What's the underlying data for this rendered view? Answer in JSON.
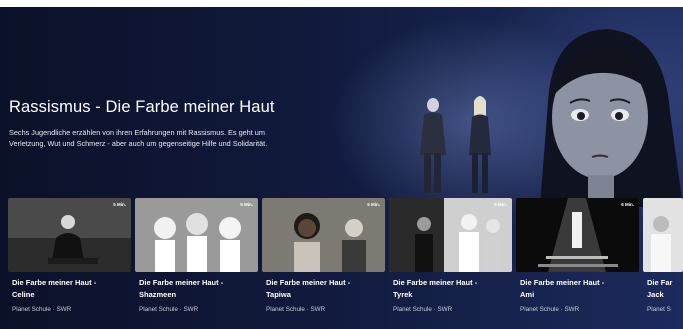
{
  "hero": {
    "title": "Rassismus - Die Farbe meiner Haut",
    "description": "Sechs Jugendliche erzählen von ihren Erfahrungen mit Rassismus. Es geht um Verletzung, Wut und Schmerz - aber auch um gegenseitige Hilfe und Solidarität."
  },
  "episodes": [
    {
      "title_line1": "Die Farbe meiner Haut -",
      "title_line2": "Celine",
      "meta": "Planet Schule · SWR",
      "duration": "5 Min."
    },
    {
      "title_line1": "Die Farbe meiner Haut -",
      "title_line2": "Shazmeen",
      "meta": "Planet Schule · SWR",
      "duration": "5 Min."
    },
    {
      "title_line1": "Die Farbe meiner Haut -",
      "title_line2": "Tapiwa",
      "meta": "Planet Schule · SWR",
      "duration": "5 Min."
    },
    {
      "title_line1": "Die Farbe meiner Haut -",
      "title_line2": "Tyrek",
      "meta": "Planet Schule · SWR",
      "duration": "6 Min."
    },
    {
      "title_line1": "Die Farbe meiner Haut -",
      "title_line2": "Ami",
      "meta": "Planet Schule · SWR",
      "duration": "6 Min."
    },
    {
      "title_line1": "Die Far",
      "title_line2": "Jack",
      "meta": "Planet S",
      "duration": ""
    }
  ],
  "colors": {
    "background": "#0e1530",
    "text": "#ffffff",
    "meta": "#c6cad8"
  }
}
